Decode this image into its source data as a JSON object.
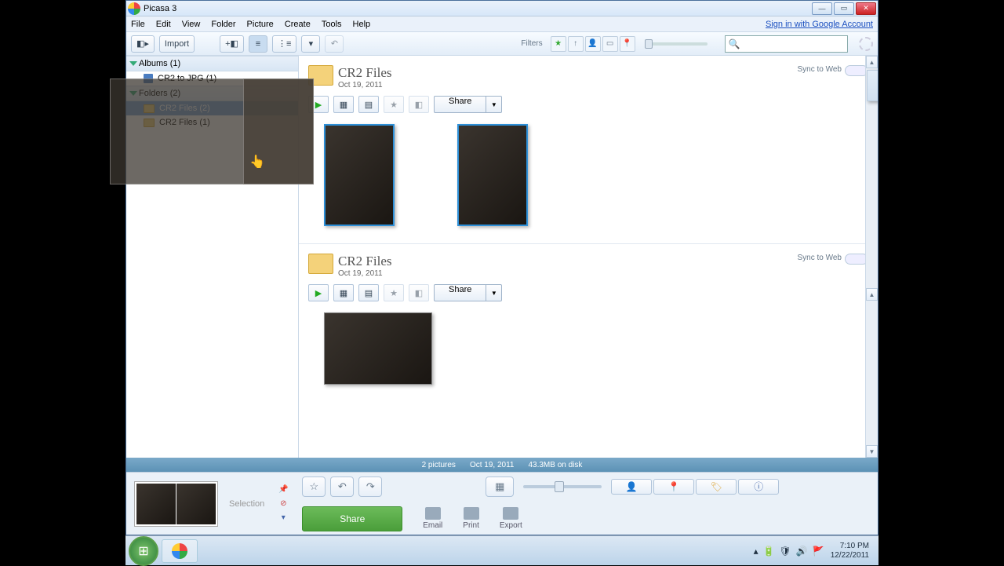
{
  "window": {
    "title": "Picasa 3"
  },
  "menu": {
    "file": "File",
    "edit": "Edit",
    "view": "View",
    "folder": "Folder",
    "picture": "Picture",
    "create": "Create",
    "tools": "Tools",
    "help": "Help",
    "signin": "Sign in with Google Account"
  },
  "toolbar": {
    "import": "Import",
    "filters_label": "Filters"
  },
  "sidebar": {
    "albums_head": "Albums (1)",
    "album_item": "CR2 to JPG (1)",
    "folders_head": "Folders (2)",
    "folder_items": [
      "CR2 Files (2)",
      "CR2 Files (1)"
    ]
  },
  "folders": [
    {
      "title": "CR2 Files",
      "date": "Oct 19, 2011",
      "sync": "Sync to Web",
      "share": "Share"
    },
    {
      "title": "CR2 Files",
      "date": "Oct 19, 2011",
      "sync": "Sync to Web",
      "share": "Share"
    }
  ],
  "status": {
    "count": "2 pictures",
    "date": "Oct 19, 2011",
    "size": "43.3MB on disk"
  },
  "bottom": {
    "selection": "Selection",
    "share": "Share",
    "email": "Email",
    "print": "Print",
    "export": "Export"
  },
  "taskbar": {
    "time": "7:10 PM",
    "date": "12/22/2011"
  }
}
